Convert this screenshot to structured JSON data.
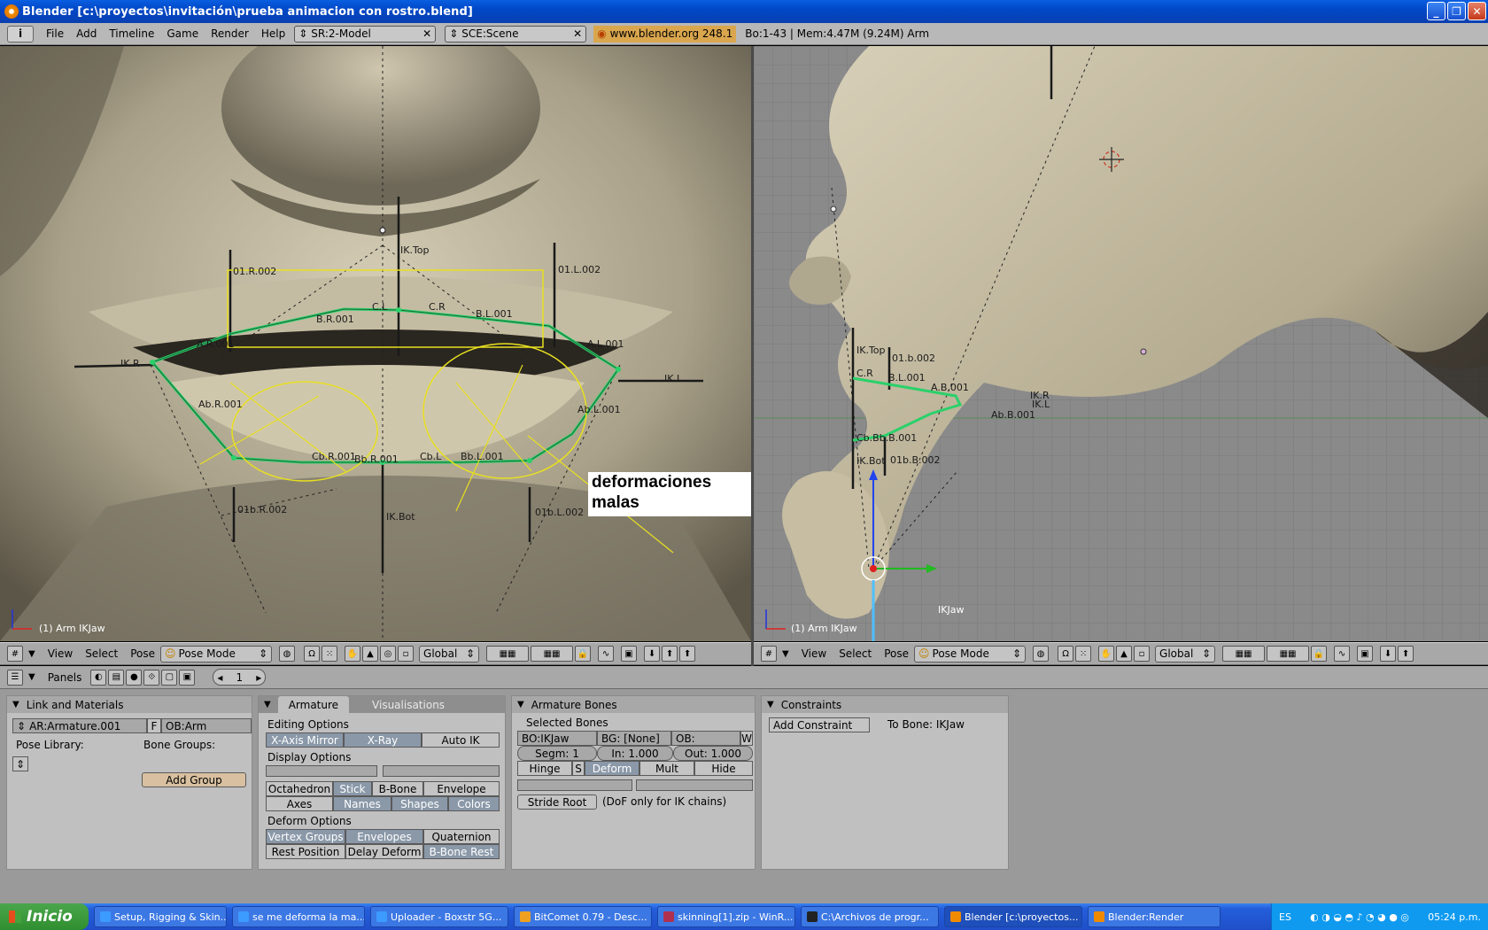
{
  "window": {
    "title": "Blender [c:\\proyectos\\invitación\\prueba animacion con rostro.blend]"
  },
  "infobar": {
    "menus": [
      "File",
      "Add",
      "Timeline",
      "Game",
      "Render",
      "Help"
    ],
    "screen": "SR:2-Model",
    "scene": "SCE:Scene",
    "url": "www.blender.org 248.1",
    "stats": "Bo:1-43  | Mem:4.47M (9.24M) Arm"
  },
  "viewport_left": {
    "object_label": "(1) Arm IKJaw",
    "bones": [
      "IK.Top",
      "01.R.002",
      "01.L.002",
      "C.L",
      "C.R",
      "B.R.001",
      "B.L.001",
      "A.R.001",
      "A.L.001",
      "IK.R",
      "IK.L",
      "Ab.R.001",
      "Ab.L.001",
      "Cb.R.001",
      "Cb.L",
      "Bb.R.001",
      "Bb.L.001",
      "01b.R.002",
      "01b.L.002",
      "IK.Bot"
    ],
    "annotation": {
      "line1": "deformaciones",
      "line2": "malas"
    }
  },
  "viewport_right": {
    "object_label": "(1) Arm IKJaw",
    "bones": [
      "IK.Top",
      "01.b.002",
      "C.R",
      "B.L.001",
      "A.B.001",
      "IK.R",
      "IK.L",
      "Ab.B.001",
      "Cb.Bb.B.001",
      "IK.Bot",
      "01b.B.002",
      "IKJaw"
    ]
  },
  "view_header": {
    "menus": [
      "View",
      "Select",
      "Pose"
    ],
    "mode": "Pose Mode",
    "orientation": "Global"
  },
  "buttons_header": {
    "panels_label": "Panels",
    "frame": "1"
  },
  "link_panel": {
    "title": "Link and Materials",
    "armature": "AR:Armature.001",
    "fake": "F",
    "object": "OB:Arm",
    "pose_library": "Pose Library:",
    "bone_groups": "Bone Groups:",
    "add_group": "Add Group"
  },
  "armature_panel": {
    "tab_active": "Armature",
    "tab_inactive": "Visualisations",
    "editing_options": "Editing Options",
    "editing_buttons": [
      "X-Axis Mirror",
      "X-Ray",
      "Auto IK"
    ],
    "display_options": "Display Options",
    "display_row1": [
      "Octahedron",
      "Stick",
      "B-Bone",
      "Envelope"
    ],
    "display_row2": [
      "Axes",
      "Names",
      "Shapes",
      "Colors"
    ],
    "deform_options": "Deform Options",
    "deform_row1": [
      "Vertex Groups",
      "Envelopes",
      "Quaternion"
    ],
    "deform_row2": [
      "Rest Position",
      "Delay Deform",
      "B-Bone Rest"
    ]
  },
  "bones_panel": {
    "title": "Armature Bones",
    "selected": "Selected Bones",
    "bone": "BO:IKJaw",
    "group": "BG: [None]",
    "object": "OB:",
    "w": "W",
    "segm": "Segm: 1",
    "in": "In: 1.000",
    "out": "Out: 1.000",
    "flags": [
      "Hinge",
      "S",
      "Deform",
      "Mult",
      "Hide"
    ],
    "stride_root": "Stride Root",
    "dof_note": "(DoF only for IK chains)"
  },
  "constraints_panel": {
    "title": "Constraints",
    "add": "Add Constraint",
    "to_bone": "To Bone: IKJaw"
  },
  "taskbar": {
    "start": "Inicio",
    "tasks": [
      "Setup, Rigging & Skin...",
      "se me deforma la ma...",
      "Uploader - Boxstr 5G...",
      "BitComet 0.79 - Desc...",
      "skinning[1].zip - WinR...",
      "C:\\Archivos de progr...",
      "Blender [c:\\proyectos...",
      "Blender:Render"
    ],
    "lang": "ES",
    "clock": "05:24 p.m."
  },
  "colors": {
    "bone_green": "#2ad16a",
    "annotation_yellow": "#e8e020",
    "title_blue": "#0a5ee0"
  }
}
